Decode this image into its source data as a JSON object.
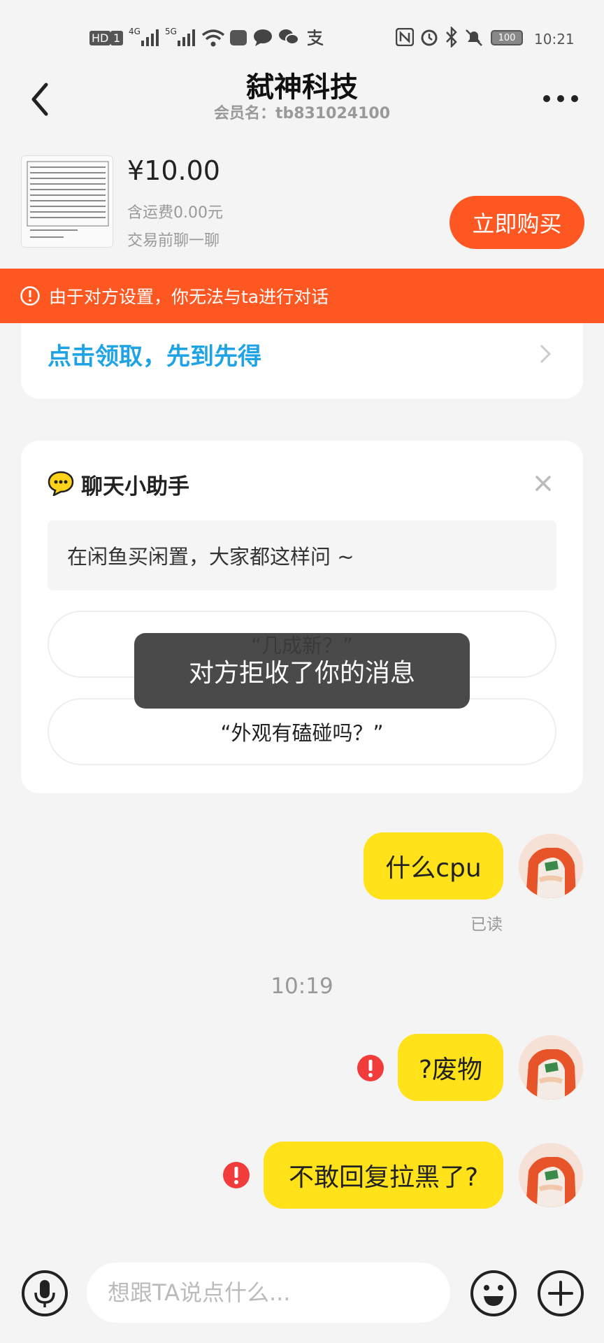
{
  "status_bar": {
    "left_indicators": [
      "HD",
      "1",
      "4G",
      "5G"
    ],
    "time": "10:21",
    "battery": "100"
  },
  "header": {
    "title": "弑神科技",
    "subtitle": "会员名：tb831024100"
  },
  "product": {
    "price": "¥10.00",
    "shipping": "含运费0.00元",
    "chat_hint": "交易前聊一聊",
    "buy_label": "立即购买"
  },
  "warning": {
    "text": "由于对方设置，你无法与ta进行对话"
  },
  "coupon": {
    "text": "点击领取，先到先得"
  },
  "assistant": {
    "title": "聊天小助手",
    "hint": "在闲鱼买闲置，大家都这样问 ~",
    "suggestions": [
      "“几成新？”",
      "“外观有磕碰吗？”"
    ]
  },
  "toast": {
    "text": "对方拒收了你的消息"
  },
  "messages": [
    {
      "text": "什么cpu",
      "status": "已读"
    },
    {
      "text": "?废物",
      "status": "failed"
    },
    {
      "text": "不敢回复拉黑了?",
      "status": "failed"
    }
  ],
  "timestamp": "10:19",
  "input": {
    "placeholder": "想跟TA说点什么..."
  },
  "colors": {
    "accent": "#ff5722",
    "bubble": "#ffe21a",
    "link": "#1ea3e6",
    "error": "#f23c3c"
  }
}
